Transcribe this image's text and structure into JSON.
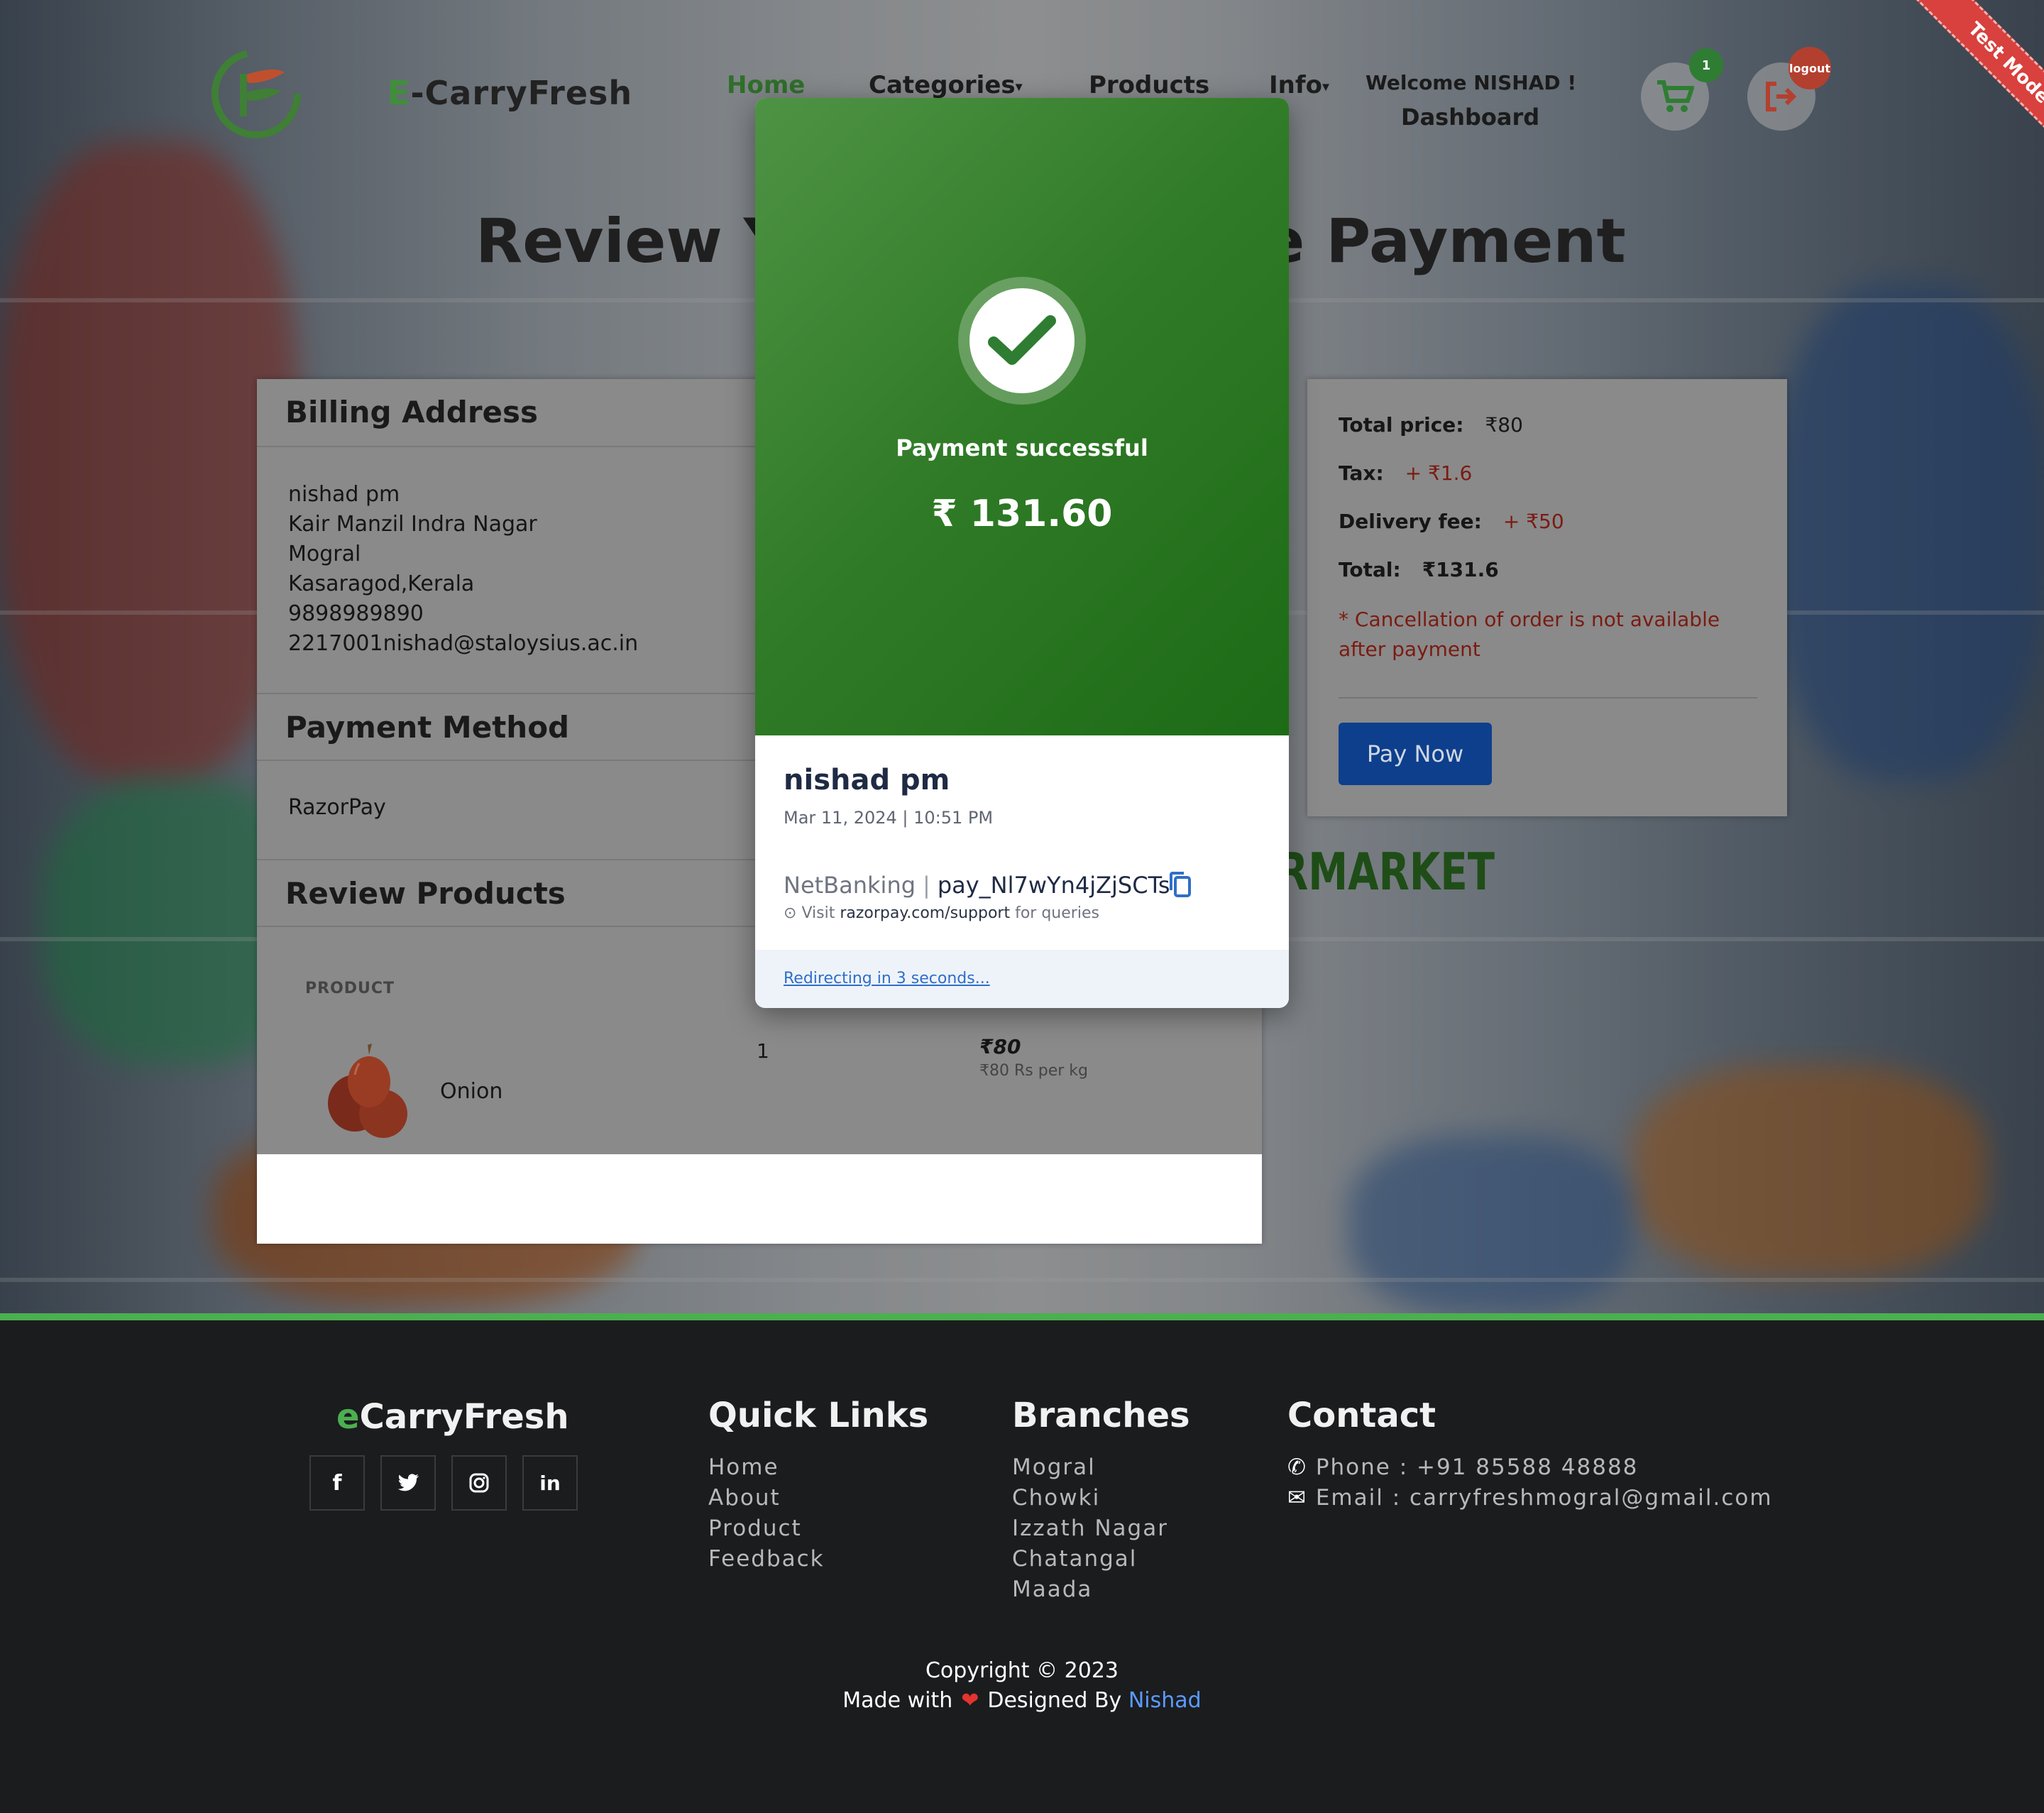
{
  "header": {
    "brand": "E-CarryFresh",
    "brand_first": "E",
    "brand_rest": "-CarryFresh",
    "nav": [
      "Home",
      "Categories",
      "Products",
      "Info"
    ],
    "welcome": "Welcome NISHAD !",
    "dashboard": "Dashboard",
    "cart_count": "1",
    "logout_label": "logout",
    "test_mode": "Test Mode"
  },
  "page": {
    "title_left": "Review Yo",
    "title_right": "e Payment"
  },
  "billing": {
    "heading": "Billing Address",
    "lines": [
      "nishad pm",
      "Kair Manzil Indra Nagar",
      "Mogral",
      "Kasaragod,Kerala",
      "9898989890",
      "2217001nishad@staloysius.ac.in"
    ]
  },
  "payment_method": {
    "heading": "Payment Method",
    "value": "RazorPay"
  },
  "review": {
    "heading": "Review Products",
    "column_product": "PRODUCT",
    "items": [
      {
        "name": "Onion",
        "qty": "1",
        "price": "₹80",
        "unit": "₹80 Rs per kg"
      }
    ]
  },
  "summary": {
    "total_price_label": "Total price:",
    "total_price": "₹80",
    "tax_label": "Tax:",
    "tax": "+ ₹1.6",
    "delivery_label": "Delivery fee:",
    "delivery": "+ ₹50",
    "total_label": "Total:",
    "total": "₹131.6",
    "cancel_note": "* Cancellation of order is not available after payment",
    "pay_now": "Pay Now"
  },
  "background_text": "RMARKET",
  "modal": {
    "status": "Payment successful",
    "amount": "₹ 131.60",
    "payer": "nishad pm",
    "datetime": "Mar 11, 2024 | 10:51 PM",
    "method": "NetBanking",
    "payment_id": "pay_Nl7wYn4jZjSCTs",
    "support_prefix": "Visit",
    "support_link": "razorpay.com/support",
    "support_suffix": "for queries",
    "redirect": "Redirecting in 3 seconds..."
  },
  "footer": {
    "brand_first": "e",
    "brand_rest": "CarryFresh",
    "social": [
      "facebook-icon",
      "twitter-icon",
      "instagram-icon",
      "linkedin-icon"
    ],
    "quick_links_heading": "Quick Links",
    "quick_links": [
      "Home",
      "About",
      "Product",
      "Feedback"
    ],
    "branches_heading": "Branches",
    "branches": [
      "Mogral",
      "Chowki",
      "Izzath Nagar",
      "Chatangal",
      "Maada"
    ],
    "contact_heading": "Contact",
    "phone": "Phone : +91 85588 48888",
    "email": "Email : carryfreshmogral@gmail.com",
    "copyright": "Copyright © 2023",
    "made_with": "Made with",
    "designed_by": "Designed By",
    "author": "Nishad"
  },
  "colors": {
    "accent_green": "#4caf50",
    "modal_green": "#2f7a26",
    "pay_button": "#0d3f8d",
    "footer_bg": "#1b1c1e",
    "link_blue": "#5a9bff"
  }
}
